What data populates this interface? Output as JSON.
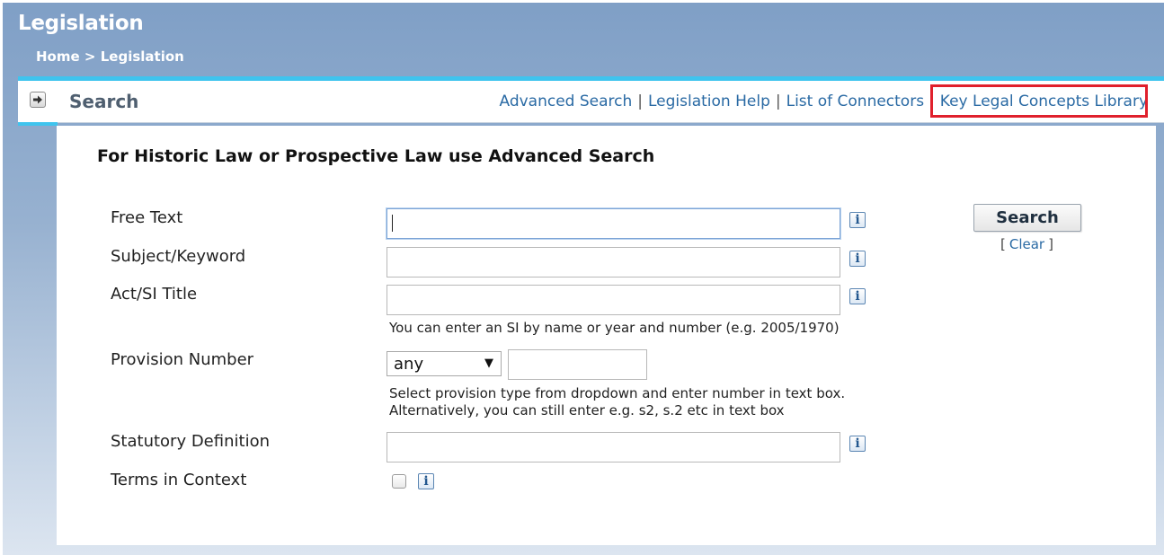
{
  "header": {
    "title": "Legislation",
    "breadcrumb": {
      "home": "Home",
      "separator": ">",
      "current": "Legislation"
    }
  },
  "toolbar": {
    "search_label": "Search",
    "links": [
      {
        "label": "Advanced Search"
      },
      {
        "label": "Legislation Help"
      },
      {
        "label": "List of Connectors"
      },
      {
        "label": "Key Legal Concepts Library"
      }
    ],
    "separator": "|"
  },
  "form": {
    "notice": "For Historic Law or Prospective Law use Advanced Search",
    "fields": {
      "free_text": {
        "label": "Free Text",
        "value": ""
      },
      "subject_keyword": {
        "label": "Subject/Keyword",
        "value": ""
      },
      "act_si_title": {
        "label": "Act/SI Title",
        "value": "",
        "hint": "You can enter an SI by name or year and number (e.g. 2005/1970)"
      },
      "provision_number": {
        "label": "Provision Number",
        "type_selected": "any",
        "number_value": "",
        "hint_line1": "Select provision type from dropdown and enter number in text box.",
        "hint_line2": "Alternatively, you can still enter e.g. s2, s.2 etc in text box"
      },
      "statutory_definition": {
        "label": "Statutory Definition",
        "value": ""
      },
      "terms_in_context": {
        "label": "Terms in Context",
        "checked": false
      }
    },
    "info_icon_glyph": "i",
    "search_button": "Search",
    "clear": {
      "open": "[",
      "label": "Clear",
      "close": "]"
    }
  },
  "colors": {
    "accent": "#3fc4ee",
    "link": "#2a6aa4",
    "highlight": "#e0202c",
    "header_bg": "#7f9fc6"
  },
  "icons": {
    "nav_arrow": "arrow-right-icon",
    "info": "info-icon",
    "dropdown": "triangle-down-icon"
  }
}
